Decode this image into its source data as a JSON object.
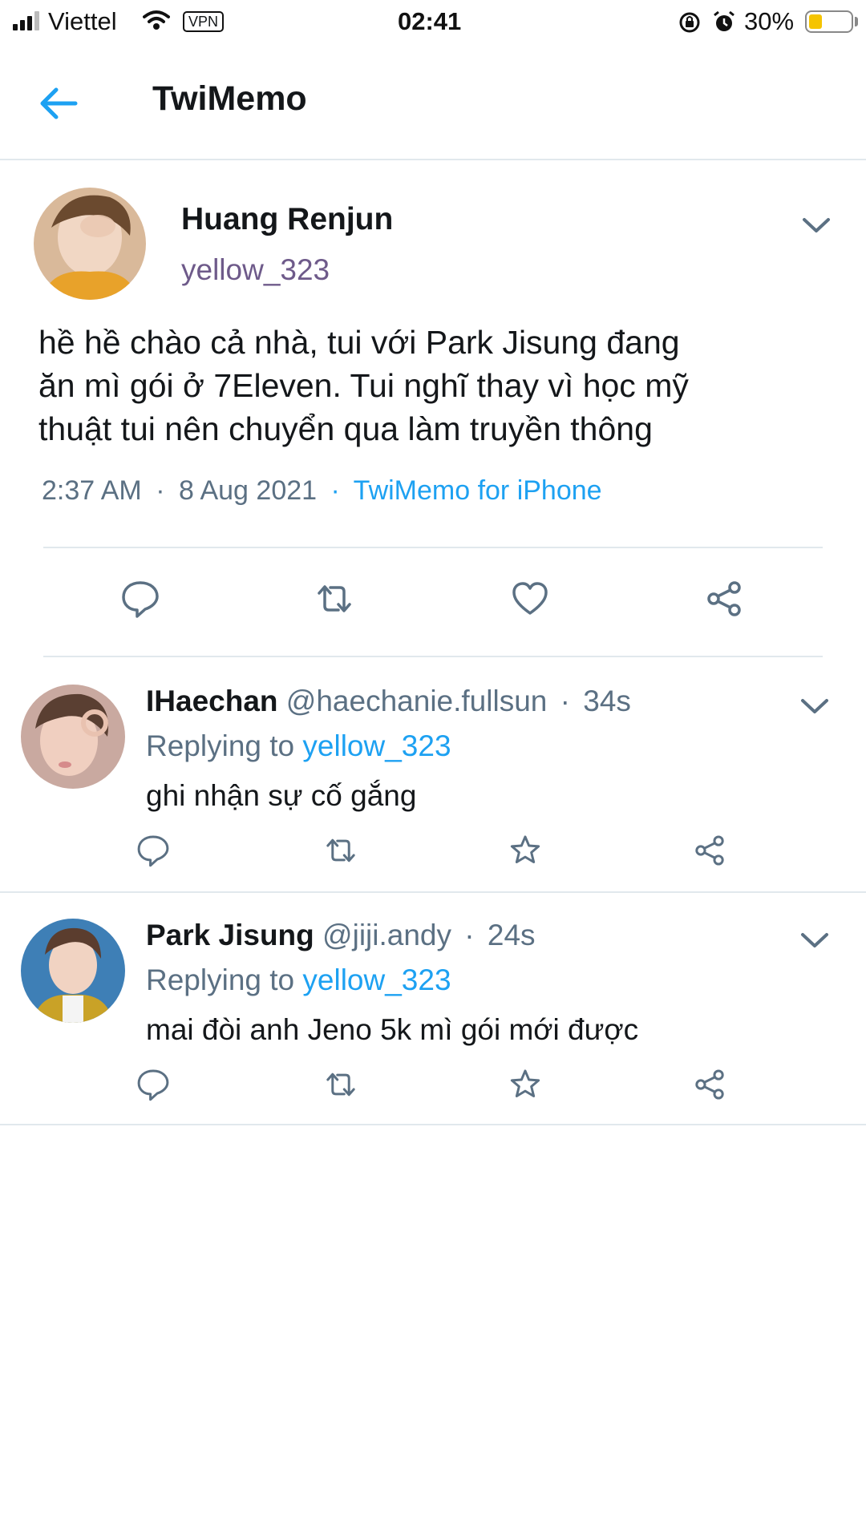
{
  "status_bar": {
    "carrier": "Viettel",
    "vpn": "VPN",
    "time": "02:41",
    "battery": "30%",
    "battery_level": 0.3
  },
  "header": {
    "title": "TwiMemo"
  },
  "main_tweet": {
    "name": "Huang Renjun",
    "handle": "yellow_323",
    "text_lines": [
      "hề hề chào cả nhà, tui với Park Jisung đang",
      "ăn mì gói ở 7Eleven. Tui nghĩ thay vì học mỹ",
      "thuật tui nên chuyển qua làm truyền thông"
    ],
    "time": "2:37 AM",
    "date": "8 Aug 2021",
    "source": "TwiMemo for iPhone",
    "sep": "·"
  },
  "replies": [
    {
      "name": "IHaechan",
      "handle": "@haechanie.fullsun",
      "age": "34s",
      "replying_prefix": "Replying to",
      "replying_to": "yellow_323",
      "text": "ghi nhận sự cố gắng"
    },
    {
      "name": "Park Jisung",
      "handle": "@jiji.andy",
      "age": "24s",
      "replying_prefix": "Replying to",
      "replying_to": "yellow_323",
      "text": "mai đòi anh Jeno 5k mì gói mới được"
    }
  ],
  "icons": {
    "back": "back-arrow-icon",
    "chevron": "chevron-down-icon",
    "reply": "comment-icon",
    "retweet": "retweet-icon",
    "like": "heart-icon",
    "star": "star-icon",
    "share": "share-icon"
  },
  "colors": {
    "accent": "#1da1f2",
    "secondary": "#5b7083",
    "divider": "#e1e8ed",
    "battery": "#f5c400"
  }
}
